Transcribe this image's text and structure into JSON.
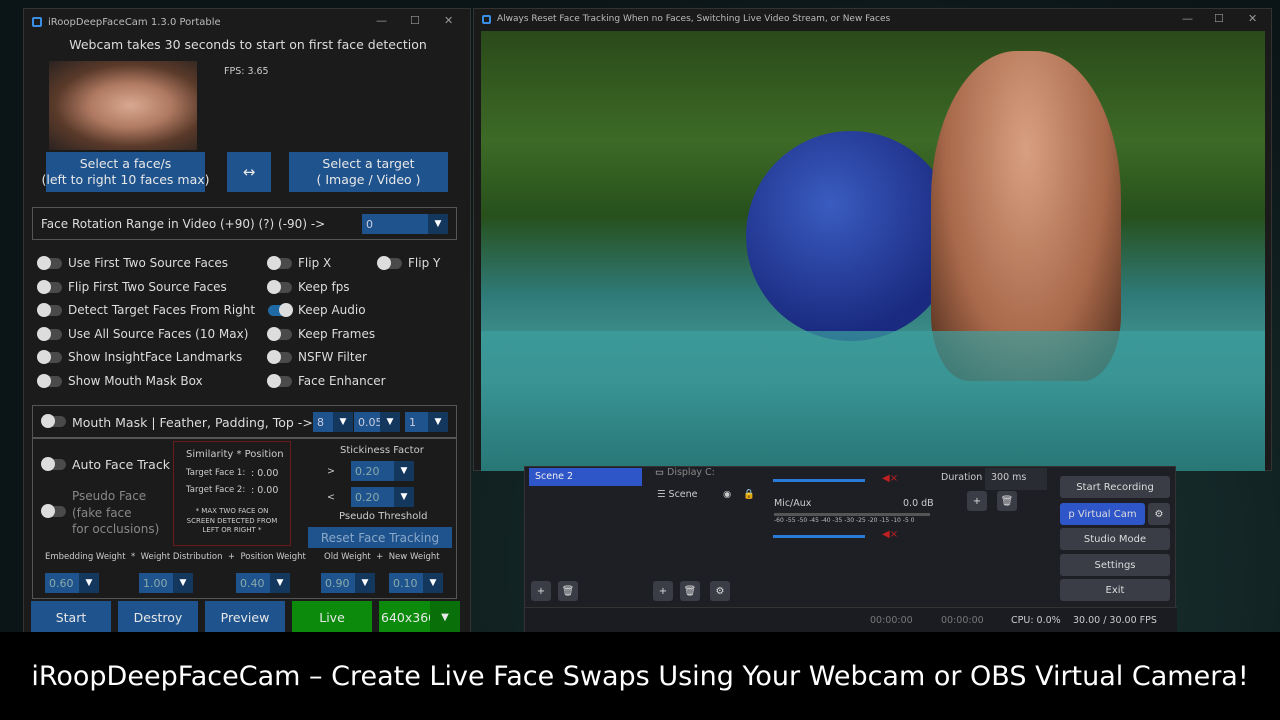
{
  "app": {
    "title": "iRoopDeepFaceCam 1.3.0 Portable",
    "notice": "Webcam takes 30 seconds to start on first face detection",
    "fps": "FPS: 3.65",
    "select_face": "Select a face/s\n(left to right 10 faces max)",
    "swap": "↔",
    "select_target": "Select a target\n( Image / Video )",
    "rotation_label": "Face Rotation Range in Video (+90) (?) (-90) ->",
    "rotation_value": "0",
    "toggles_left": [
      {
        "label": "Use First Two Source Faces",
        "on": false
      },
      {
        "label": "Flip First Two Source Faces",
        "on": false
      },
      {
        "label": "Detect Target Faces From Right",
        "on": false
      },
      {
        "label": "Use All Source Faces (10 Max)",
        "on": false
      },
      {
        "label": "Show InsightFace Landmarks",
        "on": false
      },
      {
        "label": "Show Mouth Mask Box",
        "on": false
      }
    ],
    "toggles_mid": [
      {
        "label": "Flip X",
        "on": false
      },
      {
        "label": "Keep fps",
        "on": false
      },
      {
        "label": "Keep Audio",
        "on": true
      },
      {
        "label": "Keep Frames",
        "on": false
      },
      {
        "label": "NSFW Filter",
        "on": false
      },
      {
        "label": "Face Enhancer",
        "on": false
      }
    ],
    "flip_y": {
      "label": "Flip Y",
      "on": false
    },
    "mouth_mask": {
      "label": "Mouth Mask | Feather, Padding, Top ->",
      "feather": "8",
      "padding": "0.05",
      "top": "1"
    },
    "auto_face_track": "Auto Face Track",
    "pseudo_face": "Pseudo Face\n(fake face\nfor occlusions)",
    "similarity": {
      "title": "Similarity * Position",
      "face1_label": "Target Face 1:",
      "face1_value": ": 0.00",
      "face2_label": "Target Face 2:",
      "face2_value": ": 0.00",
      "note": "* MAX TWO FACE ON SCREEN DETECTED FROM LEFT OR RIGHT *"
    },
    "stickiness": {
      "title": "Stickiness Factor",
      "gt": ">",
      "gt_value": "0.20",
      "lt": "<",
      "lt_value": "0.20"
    },
    "pseudo_threshold": "Pseudo Threshold",
    "reset_tracking": "Reset Face Tracking",
    "weights": {
      "embedding_label": "Embedding Weight",
      "op1": "*",
      "distribution_label": "Weight Distribution",
      "op2": "+",
      "position_label": "Position Weight",
      "old_label": "Old Weight",
      "op3": "+",
      "new_label": "New Weight",
      "embedding": "0.60",
      "distribution": "1.00",
      "position": "0.40",
      "old": "0.90",
      "new": "0.10"
    },
    "buttons": {
      "start": "Start",
      "destroy": "Destroy",
      "preview": "Preview",
      "live": "Live",
      "resolution": "640x360"
    }
  },
  "video_window": {
    "title": "Always Reset Face Tracking When no Faces, Switching Live Video Stream, or New Faces"
  },
  "obs": {
    "scene": "Scene 2",
    "source1": "Display C:",
    "source2": "Scene",
    "mic": "Mic/Aux",
    "mic_db": "0.0 dB",
    "meter_ticks": "-60 -55 -50 -45 -40 -35 -30 -25 -20 -15 -10 -5 0",
    "duration_label": "Duration",
    "duration": "300 ms",
    "start_recording": "Start Recording",
    "virtual_cam": "p Virtual Cam",
    "studio_mode": "Studio Mode",
    "settings": "Settings",
    "exit": "Exit",
    "rec_time1": "00:00:00",
    "rec_time2": "00:00:00",
    "cpu": "CPU: 0.0%",
    "fps": "30.00 / 30.00 FPS"
  },
  "caption": "iRoopDeepFaceCam – Create Live Face Swaps Using Your Webcam or OBS Virtual Camera!"
}
